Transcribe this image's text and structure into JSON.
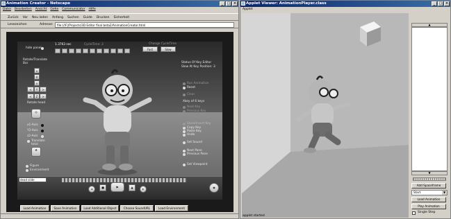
{
  "browser": {
    "title": "Animation Creator - Netscape",
    "menu": [
      "Datei",
      "Bearbeiten",
      "Ansicht",
      "Gehe",
      "Communicator",
      "Hilfe"
    ],
    "toolbar": [
      "Zurück",
      "Vor",
      "Neu laden",
      "Anfang",
      "Suchen",
      "Guide",
      "Drucken",
      "Sicherheit"
    ],
    "bookmarks_label": "Lesezeichen",
    "address_label": "Adresse:",
    "address_value": "file:///F|/Projects/3D Editor final beta2/AnimationCreator.html"
  },
  "creator": {
    "hide_panel": "hide panel",
    "time_value": "1.3763 sec",
    "cycle_time_label": "CycleTime: 2",
    "speed_label": "Change CycleTime",
    "fast": "Fast",
    "slow": "Slow",
    "rotate_label": "Rotate/Translate Bar",
    "rotate_head": "Rotate head",
    "x_axis": "x1-Axis",
    "y_axis": "Y2-Axis",
    "z_axis": "z2-Axis",
    "translate": "Translate",
    "total": "total",
    "figure": "Figure",
    "environment": "Environment",
    "status_title": "Status Of Key Editor",
    "status_line": "Slew At Key Position: 3",
    "run_animation": "Run Animation",
    "reset": "Reset",
    "clear": "Clear",
    "key_of": "Xkey of 6 keys",
    "next_key": "Next Key",
    "previous_key": "Previous Key",
    "store_insert": "Store/Insert Key",
    "copy_key": "Copy Key",
    "paste_key": "Paste Key",
    "undo": "Undo",
    "set_sound": "Set Sound",
    "next_pane": "Next Pane",
    "previous_pane": "Previous Pane",
    "set_viewpoint": "Set Viewpoint",
    "sound_field": "dead slide",
    "bottom_buttons": [
      "Load Animation",
      "Save Animation",
      "Load Additional Object",
      "Choose SoundURL",
      "Load Environment"
    ]
  },
  "viewer": {
    "title": "Applet Viewer: AnimationPlayer.class",
    "menu": "Applet",
    "status": "applet started",
    "add_spaceframe": "Add Spaceframe",
    "select_value": "Start",
    "load_animation": "Load Animation",
    "play_animation": "Play Animation",
    "single_step": "Single Step"
  }
}
